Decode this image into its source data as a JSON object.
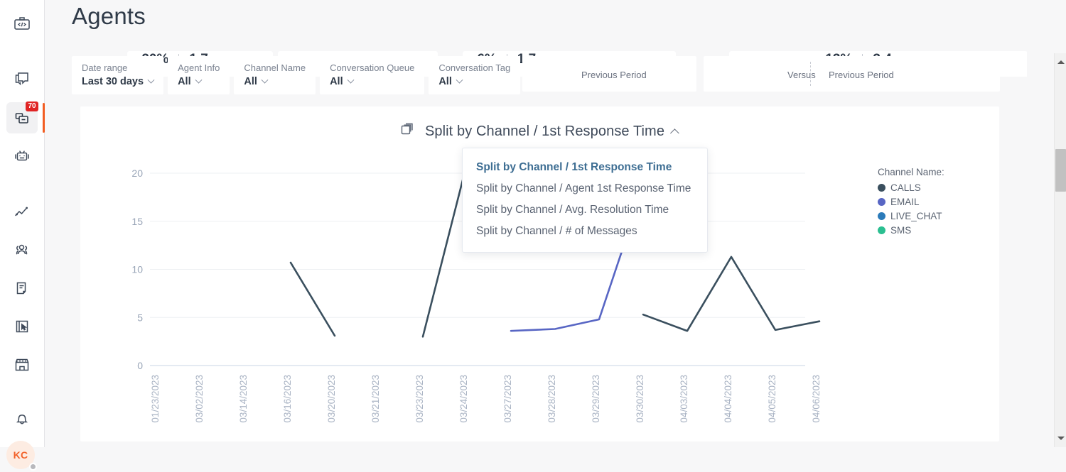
{
  "app": {
    "page_title": "Agents"
  },
  "rail": {
    "items": [
      {
        "name": "code-brackets-icon",
        "label": "Developer",
        "badge": null,
        "active": false
      },
      {
        "name": "chat-stack-icon",
        "label": "Conversations",
        "badge": null,
        "active": false
      },
      {
        "name": "inbox-icon",
        "label": "Inbox",
        "badge": "70",
        "active": true
      },
      {
        "name": "robot-icon",
        "label": "Bots",
        "badge": null,
        "active": false
      },
      {
        "name": "analytics-line-icon",
        "label": "Analytics",
        "badge": null,
        "active": false
      },
      {
        "name": "people-icon",
        "label": "Contacts",
        "badge": null,
        "active": false
      },
      {
        "name": "document-icon",
        "label": "Knowledge",
        "badge": null,
        "active": false
      },
      {
        "name": "report-cursor-icon",
        "label": "Campaigns",
        "badge": null,
        "active": false
      },
      {
        "name": "storefront-icon",
        "label": "Store",
        "badge": null,
        "active": false
      },
      {
        "name": "bell-icon",
        "label": "Notifications",
        "badge": null,
        "active": false
      }
    ],
    "avatar": {
      "initials": "KC",
      "status": "away"
    }
  },
  "kpi_strip": {
    "cards": [
      {
        "delta": "-20%",
        "value": "1.7",
        "versus_label": "Previous Period"
      },
      {
        "delta": "-6%",
        "value": "1.7",
        "versus_label": "Previous Period"
      },
      {
        "delta": "-13%",
        "value": "3.4",
        "versus_label": "Previous Period",
        "compare_label": "Versus"
      }
    ],
    "versus_label": "Versus",
    "previous_period_label": "Previous Period"
  },
  "filters": [
    {
      "label": "Date range",
      "value": "Last 30 days"
    },
    {
      "label": "Agent Info",
      "value": "All"
    },
    {
      "label": "Channel Name",
      "value": "All"
    },
    {
      "label": "Conversation Queue",
      "value": "All"
    },
    {
      "label": "Conversation Tag",
      "value": "All"
    }
  ],
  "chart_panel": {
    "title": "Split by Channel / 1st Response Time",
    "title_icon": "layers-stack-icon",
    "expanded": true
  },
  "dropdown": {
    "open": true,
    "options": [
      {
        "label": "Split by Channel / 1st Response Time",
        "selected": true
      },
      {
        "label": "Split by Channel / Agent 1st Response Time",
        "selected": false
      },
      {
        "label": "Split by Channel / Avg. Resolution Time",
        "selected": false
      },
      {
        "label": "Split by Channel / # of Messages",
        "selected": false
      }
    ]
  },
  "chart_data": {
    "type": "line",
    "title": "Split by Channel / 1st Response Time",
    "xlabel": "",
    "ylabel": "",
    "ylim": [
      0,
      22
    ],
    "yticks": [
      0,
      5,
      10,
      15,
      20
    ],
    "grid": true,
    "legend_position": "right",
    "legend_title": "Channel Name:",
    "categories": [
      "01/23/2023",
      "03/02/2023",
      "03/14/2023",
      "03/16/2023",
      "03/20/2023",
      "03/21/2023",
      "03/23/2023",
      "03/24/2023",
      "03/27/2023",
      "03/28/2023",
      "03/29/2023",
      "03/30/2023",
      "04/03/2023",
      "04/04/2023",
      "04/05/2023",
      "04/06/2023"
    ],
    "series": [
      {
        "name": "CALLS",
        "color": "#3a4f5e",
        "values": [
          null,
          null,
          null,
          10.7,
          3.1,
          null,
          3.0,
          21.0,
          null,
          null,
          null,
          5.3,
          3.6,
          11.3,
          3.7,
          4.6
        ]
      },
      {
        "name": "EMAIL",
        "color": "#5866c4",
        "values": [
          null,
          null,
          null,
          null,
          null,
          null,
          null,
          null,
          3.6,
          3.8,
          4.8,
          18.5,
          null,
          null,
          null,
          null
        ]
      },
      {
        "name": "LIVE_CHAT",
        "color": "#2b7bba",
        "values": [
          null,
          null,
          null,
          null,
          null,
          null,
          null,
          null,
          null,
          null,
          null,
          null,
          null,
          null,
          null,
          null
        ]
      },
      {
        "name": "SMS",
        "color": "#2bbf91",
        "values": [
          null,
          null,
          null,
          null,
          null,
          null,
          null,
          null,
          null,
          null,
          null,
          null,
          null,
          null,
          null,
          null
        ]
      }
    ]
  },
  "scrollbar": {
    "up_arrow": "scroll-up",
    "down_arrow": "scroll-down",
    "thumb_position_pct": 24
  }
}
